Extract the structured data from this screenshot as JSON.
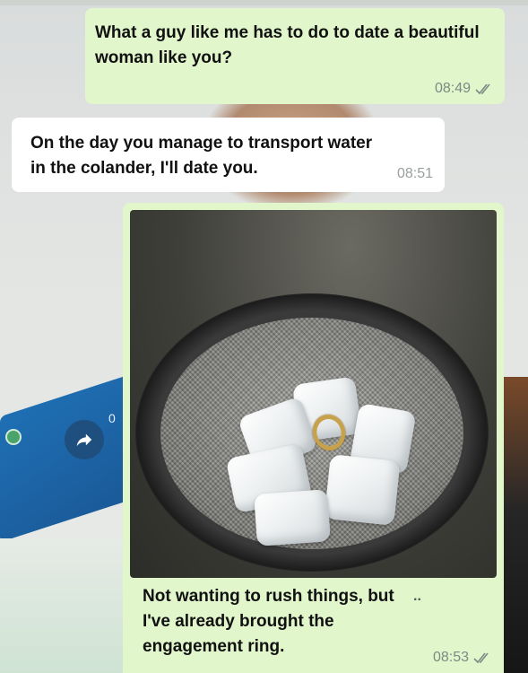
{
  "messages": [
    {
      "id": "m1",
      "direction": "outgoing",
      "text": "What a guy like me has to do to date a beautiful woman like you?",
      "time": "08:49",
      "status": "read"
    },
    {
      "id": "m2",
      "direction": "incoming",
      "text": "On the day you manage to transport water in the colander, I'll date you.",
      "time": "08:51"
    },
    {
      "id": "m3",
      "direction": "outgoing",
      "has_image": true,
      "text": "Not wanting to rush things, but I've already brought the engagement ring.",
      "time": "08:53",
      "status": "read"
    }
  ],
  "background": {
    "overlay_count": "0"
  },
  "colors": {
    "outgoing_bubble": "#e1f6cb",
    "incoming_bubble": "#ffffff",
    "tick": "#7c8a85"
  }
}
